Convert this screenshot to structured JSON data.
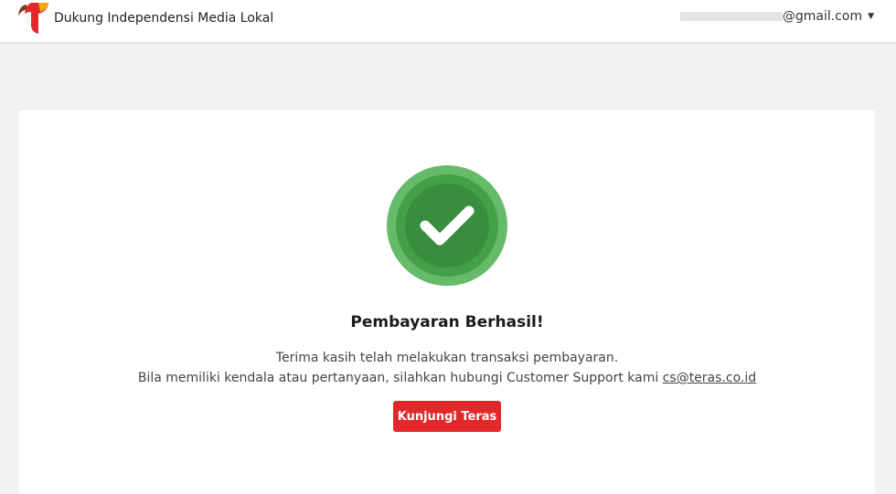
{
  "header": {
    "tagline": "Dukung Independensi Media Lokal",
    "account_email_suffix": "@gmail.com",
    "account_dropdown_icon": "caret-down-icon"
  },
  "success": {
    "icon": "check-circle-icon",
    "title": "Pembayaran Berhasil!",
    "message_line1": "Terima kasih telah melakukan transaksi pembayaran.",
    "message_line2": "Bila memiliki kendala atau pertanyaan, silahkan hubungi Customer Support kami",
    "support_email": "cs@teras.co.id",
    "button_label": "Kunjungi Teras"
  },
  "colors": {
    "brand_red": "#e2282b",
    "success_green": "#4caf50"
  }
}
